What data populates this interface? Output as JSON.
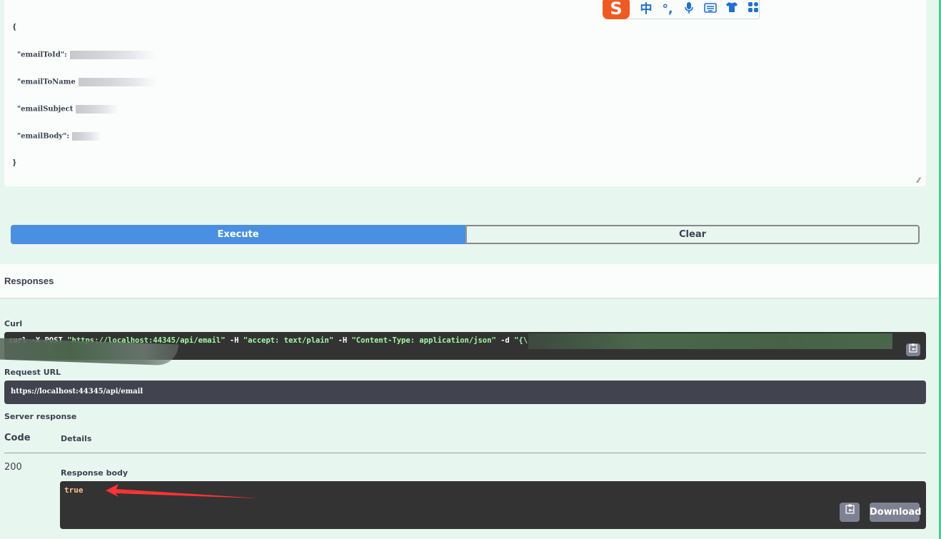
{
  "request_body": {
    "lines": [
      "{",
      "  \"emailToId\":",
      "  \"emailToName",
      "  \"emailSubject",
      "  \"emailBody\":",
      "}"
    ],
    "redacted": true
  },
  "ime_toolbar": {
    "logo": "S",
    "items": [
      {
        "name": "chinese-mode-icon",
        "glyph": "中"
      },
      {
        "name": "punctuation-icon",
        "glyph": "°,"
      },
      {
        "name": "microphone-icon",
        "glyph": "🎙"
      },
      {
        "name": "keyboard-icon",
        "glyph": "⌨"
      },
      {
        "name": "skin-icon",
        "glyph": "👕"
      },
      {
        "name": "toolbox-icon",
        "glyph": "▦"
      }
    ]
  },
  "actions": {
    "execute_label": "Execute",
    "clear_label": "Clear"
  },
  "responses": {
    "title": "Responses",
    "curl_label": "Curl",
    "curl": {
      "prefix": "curl -X POST ",
      "url": "\"https://localhost:44345/api/email\"",
      "h1_flag": " -H  ",
      "h1": "\"accept: text/plain\"",
      "h2_flag": " -H  ",
      "h2": "\"Content-Type: application/json\"",
      "d_flag": " -d ",
      "d": "\"{\\"
    },
    "request_url_label": "Request URL",
    "request_url": "https://localhost:44345/api/email",
    "server_response_label": "Server response",
    "code_header": "Code",
    "details_header": "Details",
    "status_code": "200",
    "response_body_label": "Response body",
    "response_body": "true",
    "download_label": "Download"
  },
  "colors": {
    "execute": "#4990e2",
    "accent_border": "#49cc90",
    "code_bg": "#333333",
    "annotation_arrow": "#ff3333"
  }
}
